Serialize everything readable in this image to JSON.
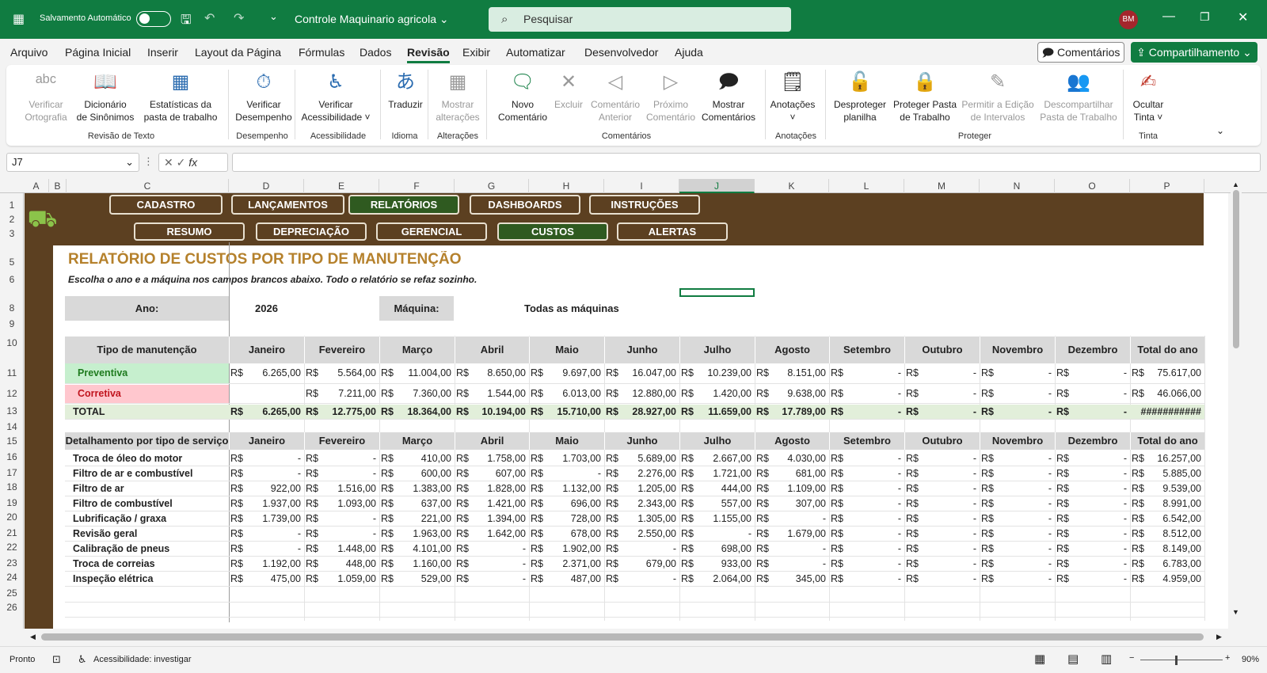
{
  "titlebar": {
    "autosave_label": "Salvamento Automático",
    "doc_title": "Controle Maquinario agricola",
    "search_placeholder": "Pesquisar",
    "user_initials": "BM"
  },
  "menu": {
    "tabs": [
      "Arquivo",
      "Página Inicial",
      "Inserir",
      "Layout da Página",
      "Fórmulas",
      "Dados",
      "Revisão",
      "Exibir",
      "Automatizar",
      "Desenvolvedor",
      "Ajuda"
    ],
    "active": "Revisão",
    "comments_label": "Comentários",
    "share_label": "Compartilhamento"
  },
  "ribbon": {
    "buttons": [
      {
        "l1": "Verificar",
        "l2": "Ortografia",
        "icon": "spellcheck-icon",
        "disabled": true
      },
      {
        "l1": "Dicionário",
        "l2": "de Sinônimos",
        "icon": "thesaurus-icon",
        "disabled": false
      },
      {
        "l1": "Estatísticas da",
        "l2": "pasta de trabalho",
        "icon": "workbook-stats-icon",
        "disabled": false
      },
      {
        "l1": "Verificar",
        "l2": "Desempenho",
        "icon": "performance-icon",
        "disabled": false
      },
      {
        "l1": "Verificar",
        "l2": "Acessibilidade ˅",
        "icon": "accessibility-icon",
        "disabled": false
      },
      {
        "l1": "Traduzir",
        "l2": "",
        "icon": "translate-icon",
        "disabled": false
      },
      {
        "l1": "Mostrar",
        "l2": "alterações",
        "icon": "show-changes-icon",
        "disabled": true
      },
      {
        "l1": "Novo",
        "l2": "Comentário",
        "icon": "new-comment-icon",
        "disabled": false
      },
      {
        "l1": "Excluir",
        "l2": "",
        "icon": "delete-comment-icon",
        "disabled": true
      },
      {
        "l1": "Comentário",
        "l2": "Anterior",
        "icon": "previous-comment-icon",
        "disabled": true
      },
      {
        "l1": "Próximo",
        "l2": "Comentário",
        "icon": "next-comment-icon",
        "disabled": true
      },
      {
        "l1": "Mostrar",
        "l2": "Comentários",
        "icon": "show-comments-icon",
        "disabled": false
      },
      {
        "l1": "Anotações",
        "l2": "˅",
        "icon": "notes-icon",
        "disabled": false
      },
      {
        "l1": "Desproteger",
        "l2": "planilha",
        "icon": "unprotect-sheet-icon",
        "disabled": false
      },
      {
        "l1": "Proteger Pasta",
        "l2": "de Trabalho",
        "icon": "protect-workbook-icon",
        "disabled": false
      },
      {
        "l1": "Permitir a Edição",
        "l2": "de Intervalos",
        "icon": "allow-edit-ranges-icon",
        "disabled": true
      },
      {
        "l1": "Descompartilhar",
        "l2": "Pasta de Trabalho",
        "icon": "unshare-workbook-icon",
        "disabled": true
      },
      {
        "l1": "Ocultar",
        "l2": "Tinta ˅",
        "icon": "hide-ink-icon",
        "disabled": false
      }
    ],
    "groups": [
      "Revisão de Texto",
      "Desempenho",
      "Acessibilidade",
      "Idioma",
      "Alterações",
      "Comentários",
      "Anotações",
      "Proteger",
      "Tinta"
    ]
  },
  "formula_bar": {
    "name_box": "J7",
    "fx": "fx",
    "formula": ""
  },
  "columns": [
    "A",
    "B",
    "C",
    "D",
    "E",
    "F",
    "G",
    "H",
    "I",
    "J",
    "K",
    "L",
    "M",
    "N",
    "O",
    "P"
  ],
  "selected_column": "J",
  "rows": [
    "1",
    "2",
    "3",
    "5",
    "6",
    "8",
    "9",
    "10",
    "11",
    "12",
    "13",
    "14",
    "15",
    "16",
    "17",
    "18",
    "19",
    "20",
    "21",
    "22",
    "23",
    "24",
    "25",
    "26"
  ],
  "nav": {
    "row1": [
      "CADASTRO",
      "LANÇAMENTOS",
      "RELATÓRIOS",
      "DASHBOARDS",
      "INSTRUÇÕES"
    ],
    "row2": [
      "RESUMO",
      "DEPRECIAÇÃO",
      "GERENCIAL",
      "CUSTOS",
      "ALERTAS"
    ],
    "active1": "RELATÓRIOS",
    "active2": "CUSTOS"
  },
  "report": {
    "title": "RELATÓRIO DE CUSTOS POR TIPO DE MANUTENÇÃO",
    "subtitle": "Escolha o ano e a máquina nos campos brancos abaixo. Todo o relatório se refaz sozinho.",
    "year_label": "Ano:",
    "year_value": "2026",
    "machine_label": "Máquina:",
    "machine_value": "Todas as máquinas",
    "currency": "R$",
    "months": [
      "Janeiro",
      "Fevereiro",
      "Março",
      "Abril",
      "Maio",
      "Junho",
      "Julho",
      "Agosto",
      "Setembro",
      "Outubro",
      "Novembro",
      "Dezembro",
      "Total do ano"
    ],
    "summary_header": "Tipo de manutenção",
    "summary": [
      {
        "label": "Preventiva",
        "values": [
          "6.265,00",
          "5.564,00",
          "11.004,00",
          "8.650,00",
          "9.697,00",
          "16.047,00",
          "10.239,00",
          "8.151,00",
          "-",
          "-",
          "-",
          "-",
          "75.617,00"
        ]
      },
      {
        "label": "Corretiva",
        "values": [
          "",
          "7.211,00",
          "7.360,00",
          "1.544,00",
          "6.013,00",
          "12.880,00",
          "1.420,00",
          "9.638,00",
          "-",
          "-",
          "-",
          "-",
          "46.066,00"
        ]
      }
    ],
    "total": {
      "label": "TOTAL",
      "values": [
        "6.265,00",
        "12.775,00",
        "18.364,00",
        "10.194,00",
        "15.710,00",
        "28.927,00",
        "11.659,00",
        "17.789,00",
        "-",
        "-",
        "-",
        "-",
        "###########"
      ]
    },
    "detail_header": "Detalhamento por tipo de serviço",
    "details": [
      {
        "label": "Troca de óleo do motor",
        "values": [
          "-",
          "-",
          "410,00",
          "1.758,00",
          "1.703,00",
          "5.689,00",
          "2.667,00",
          "4.030,00",
          "-",
          "-",
          "-",
          "-",
          "16.257,00"
        ]
      },
      {
        "label": "Filtro de ar e combustível",
        "values": [
          "-",
          "-",
          "600,00",
          "607,00",
          "-",
          "2.276,00",
          "1.721,00",
          "681,00",
          "-",
          "-",
          "-",
          "-",
          "5.885,00"
        ]
      },
      {
        "label": "Filtro de ar",
        "values": [
          "922,00",
          "1.516,00",
          "1.383,00",
          "1.828,00",
          "1.132,00",
          "1.205,00",
          "444,00",
          "1.109,00",
          "-",
          "-",
          "-",
          "-",
          "9.539,00"
        ]
      },
      {
        "label": "Filtro de combustível",
        "values": [
          "1.937,00",
          "1.093,00",
          "637,00",
          "1.421,00",
          "696,00",
          "2.343,00",
          "557,00",
          "307,00",
          "-",
          "-",
          "-",
          "-",
          "8.991,00"
        ]
      },
      {
        "label": "Lubrificação / graxa",
        "values": [
          "1.739,00",
          "-",
          "221,00",
          "1.394,00",
          "728,00",
          "1.305,00",
          "1.155,00",
          "-",
          "-",
          "-",
          "-",
          "-",
          "6.542,00"
        ]
      },
      {
        "label": "Revisão geral",
        "values": [
          "-",
          "-",
          "1.963,00",
          "1.642,00",
          "678,00",
          "2.550,00",
          "-",
          "1.679,00",
          "-",
          "-",
          "-",
          "-",
          "8.512,00"
        ]
      },
      {
        "label": "Calibração de pneus",
        "values": [
          "-",
          "1.448,00",
          "4.101,00",
          "-",
          "1.902,00",
          "-",
          "698,00",
          "-",
          "-",
          "-",
          "-",
          "-",
          "8.149,00"
        ]
      },
      {
        "label": "Troca de correias",
        "values": [
          "1.192,00",
          "448,00",
          "1.160,00",
          "-",
          "2.371,00",
          "679,00",
          "933,00",
          "-",
          "-",
          "-",
          "-",
          "-",
          "6.783,00"
        ]
      },
      {
        "label": "Inspeção elétrica",
        "values": [
          "475,00",
          "1.059,00",
          "529,00",
          "-",
          "487,00",
          "-",
          "2.064,00",
          "345,00",
          "-",
          "-",
          "-",
          "-",
          "4.959,00"
        ]
      }
    ]
  },
  "status": {
    "ready": "Pronto",
    "accessibility": "Acessibilidade: investigar",
    "zoom": "90%"
  },
  "colors": {
    "excel_green": "#107c41",
    "brown": "#5c4021",
    "title_orange": "#b5812c",
    "preventiva_bg": "#c6efce",
    "corretiva_bg": "#ffc7ce",
    "total_bg": "#e2efda"
  }
}
